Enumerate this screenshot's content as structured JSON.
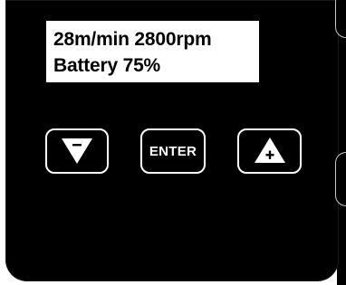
{
  "display": {
    "line1": "28m/min 2800rpm",
    "line2": "Battery 75%"
  },
  "keys": {
    "down_icon": "down-triangle-minus-icon",
    "enter_label": "ENTER",
    "up_icon": "up-triangle-plus-icon"
  },
  "colors": {
    "panel": "#000000",
    "display_bg": "#ffffff",
    "key_border": "#ffffff"
  }
}
